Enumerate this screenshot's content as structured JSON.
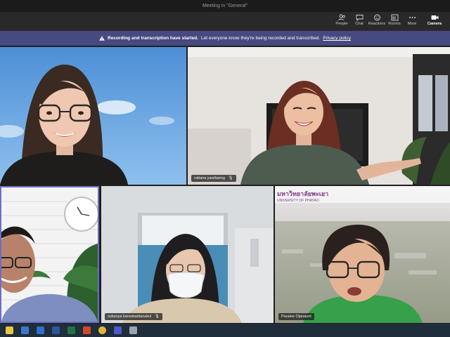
{
  "window": {
    "title": "Meeting in \"General\""
  },
  "toolbar": {
    "items": [
      {
        "label": "People",
        "icon": "people-icon"
      },
      {
        "label": "Chat",
        "icon": "chat-icon"
      },
      {
        "label": "Reactions",
        "icon": "reactions-icon"
      },
      {
        "label": "Rooms",
        "icon": "rooms-icon"
      },
      {
        "label": "More",
        "icon": "more-icon"
      },
      {
        "label": "Camera",
        "icon": "camera-icon"
      }
    ]
  },
  "banner": {
    "bold": "Recording and transcription have started.",
    "text": "Let everyone know they're being recorded and transcribed.",
    "link": "Privacy policy",
    "background": "#474a80"
  },
  "participants": [
    {
      "name": "",
      "tile": "top-left"
    },
    {
      "name": "rattana yawilawng",
      "tile": "top-right"
    },
    {
      "name": "",
      "tile": "bottom-left"
    },
    {
      "name": "sukanya kaowiwattanakul",
      "tile": "bottom-middle"
    },
    {
      "name": "Paralee Ojanaunt",
      "tile": "bottom-right"
    }
  ],
  "background_sign": {
    "text": "มหาวิทยาลัยพะเยา",
    "sub": "UNIVERSITY OF PHAYAO"
  },
  "taskbar": {
    "icons": [
      "windows-icon",
      "search-icon",
      "file-explorer-icon",
      "store-icon",
      "word-icon",
      "excel-icon",
      "powerpoint-icon",
      "chrome-icon",
      "teams-icon",
      "snip-icon"
    ]
  }
}
